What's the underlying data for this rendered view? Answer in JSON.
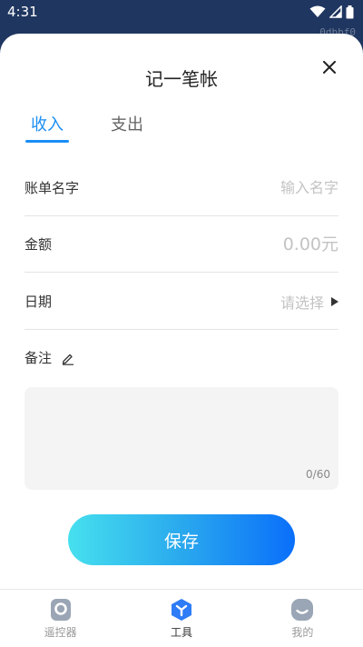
{
  "status_bar": {
    "time": "4:31"
  },
  "debug_tag": "0dbbf0",
  "sheet": {
    "title": "记一笔帐",
    "tabs": [
      {
        "label": "收入",
        "active": true
      },
      {
        "label": "支出",
        "active": false
      }
    ],
    "fields": {
      "name": {
        "label": "账单名字",
        "placeholder": "输入名字"
      },
      "amount": {
        "label": "金额",
        "placeholder": "0.00元"
      },
      "date": {
        "label": "日期",
        "placeholder": "请选择"
      }
    },
    "note": {
      "label": "备注",
      "counter": "0/60"
    },
    "save_label": "保存"
  },
  "bottom_nav": [
    {
      "label": "遥控器",
      "icon": "remote-icon",
      "active": false
    },
    {
      "label": "工具",
      "icon": "tools-icon",
      "active": true
    },
    {
      "label": "我的",
      "icon": "profile-icon",
      "active": false
    }
  ],
  "colors": {
    "accent": "#1a8ef5",
    "backdrop": "#1f3660",
    "gradient_start": "#46e0ee",
    "gradient_end": "#0a6ffa"
  }
}
